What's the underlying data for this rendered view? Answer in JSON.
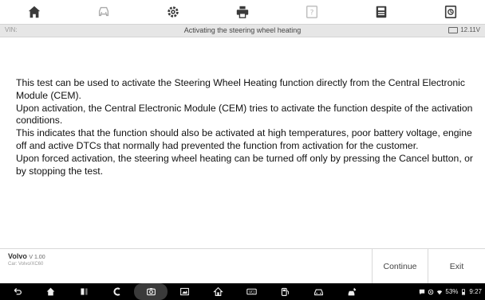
{
  "toolbar": {
    "buttons": [
      {
        "name": "home",
        "icon": "home-icon"
      },
      {
        "name": "vehicle",
        "icon": "car-swap-icon"
      },
      {
        "name": "settings",
        "icon": "gear-icon"
      },
      {
        "name": "print",
        "icon": "printer-icon"
      },
      {
        "name": "help",
        "icon": "help-icon"
      },
      {
        "name": "save",
        "icon": "save-icon"
      },
      {
        "name": "datalog",
        "icon": "datalog-icon"
      }
    ]
  },
  "header": {
    "vin_label": "VIN:",
    "title": "Activating the steering wheel heating",
    "voltage": "12.11V"
  },
  "main": {
    "paragraphs": [
      "This test can be used to activate the Steering Wheel Heating function directly from the Central Electronic Module (CEM).",
      "Upon activation, the Central Electronic Module (CEM) tries to activate the function despite of the activation conditions.",
      "This indicates that the function should also be activated at high temperatures, poor battery voltage, engine off and active DTCs that normally had prevented the function from activation for the customer.",
      "Upon forced activation, the steering wheel heating can be turned off only by pressing the Cancel button, or by stopping the test."
    ]
  },
  "footer": {
    "make": "Volvo",
    "version": "V 1.00",
    "car": "Car: Volvo/XC60",
    "continue_label": "Continue",
    "exit_label": "Exit"
  },
  "navbar": {
    "battery_percent": "53%",
    "time": "9:27"
  },
  "colors": {
    "toolbar_icon": "#3a3a3a",
    "titlebar_bg": "#e6e6e6",
    "navbar_bg": "#000000"
  }
}
